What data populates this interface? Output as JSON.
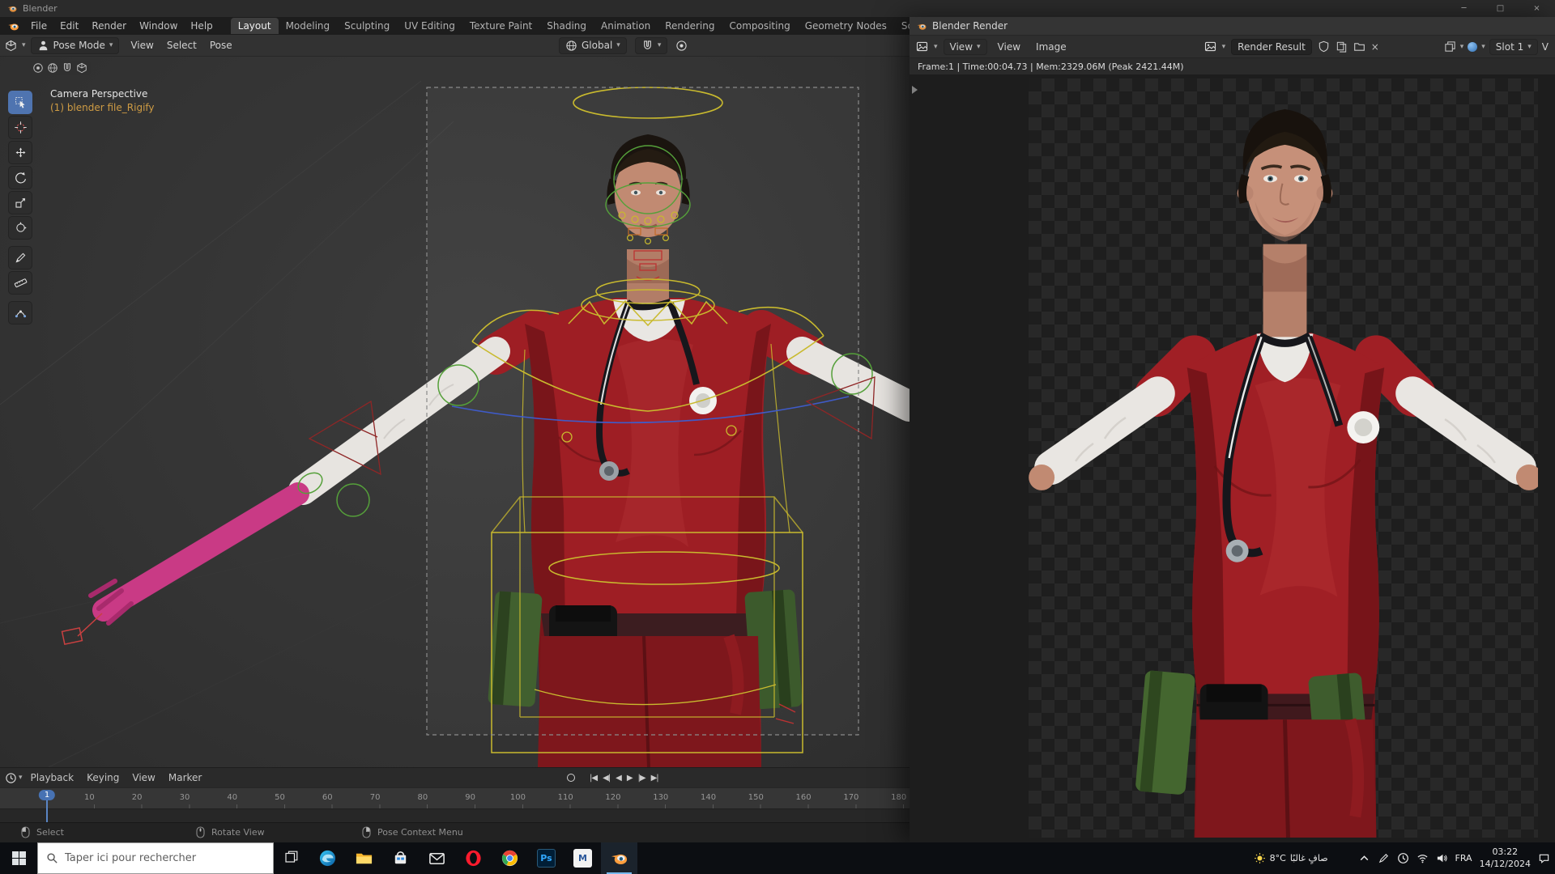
{
  "ui": {
    "caret": "▾"
  },
  "colors": {
    "accent_blue": "#4772b3",
    "blender_orange": "#ff9e3d",
    "scrub_red": "#a01f25",
    "rig_yellow": "#c9ba2e",
    "rig_green": "#55a03a",
    "rig_red": "#8f2626",
    "rig_blue": "#3f5bc8",
    "selected_magenta": "#c93a85"
  },
  "main_window": {
    "title": "Blender",
    "window_controls": {
      "minimize": "─",
      "maximize": "□",
      "close": "×"
    },
    "menubar": {
      "menus": [
        "File",
        "Edit",
        "Render",
        "Window",
        "Help"
      ],
      "workspaces": [
        "Layout",
        "Modeling",
        "Sculpting",
        "UV Editing",
        "Texture Paint",
        "Shading",
        "Animation",
        "Rendering",
        "Compositing",
        "Geometry Nodes",
        "Scripting"
      ],
      "active_workspace": "Layout",
      "add_workspace": "+"
    },
    "viewport_header": {
      "mode": "Pose Mode",
      "menus": [
        "View",
        "Select",
        "Pose"
      ],
      "orientation": "Global"
    },
    "viewport": {
      "view_label": "Camera Perspective",
      "collection_label": "(1) blender file_Rigify",
      "tool_groups": [
        [
          "select-box",
          "cursor",
          "move",
          "rotate",
          "scale",
          "transform"
        ],
        [
          "annotate",
          "measure"
        ],
        [
          "pose-tool"
        ]
      ],
      "active_tool": "select-box"
    },
    "timeline": {
      "menus": [
        "Playback",
        "Keying",
        "View",
        "Marker"
      ],
      "transport": [
        {
          "name": "jump-to-start",
          "glyph": "|◀"
        },
        {
          "name": "prev-keyframe",
          "glyph": "◀|"
        },
        {
          "name": "play-reverse",
          "glyph": "◀"
        },
        {
          "name": "play",
          "glyph": "▶"
        },
        {
          "name": "next-keyframe",
          "glyph": "|▶"
        },
        {
          "name": "jump-to-end",
          "glyph": "▶|"
        }
      ],
      "frames": [
        "1",
        "10",
        "20",
        "30",
        "40",
        "50",
        "60",
        "70",
        "80",
        "90",
        "100",
        "110",
        "120",
        "130",
        "140",
        "150",
        "160",
        "170",
        "180"
      ],
      "current_frame": "1"
    },
    "status_bar": [
      {
        "label": "Select"
      },
      {
        "label": "Rotate View"
      },
      {
        "label": "Pose Context Menu"
      }
    ]
  },
  "render_window": {
    "title": "Blender Render",
    "header": {
      "view_dropdown": "View",
      "menu_view": "View",
      "menu_image": "Image",
      "image_name": "Render Result",
      "close_x": "×",
      "slot": "Slot 1",
      "view_layer_cut": "V"
    },
    "stats": "Frame:1 | Time:00:04.73 | Mem:2329.06M (Peak 2421.44M)"
  },
  "taskbar": {
    "search": {
      "placeholder": "Taper ici pour rechercher"
    },
    "apps": [
      {
        "name": "edge"
      },
      {
        "name": "file-explorer"
      },
      {
        "name": "store"
      },
      {
        "name": "mail"
      },
      {
        "name": "opera"
      },
      {
        "name": "chrome"
      },
      {
        "name": "photoshop",
        "glyph": "Ps"
      },
      {
        "name": "word",
        "glyph": "M"
      },
      {
        "name": "blender",
        "active": true
      }
    ],
    "tray": {
      "weather_temp": "8°C",
      "weather_text": "صافٍ غالبًا",
      "language": "FRA",
      "time": "03:22",
      "date": "14/12/2024"
    }
  }
}
